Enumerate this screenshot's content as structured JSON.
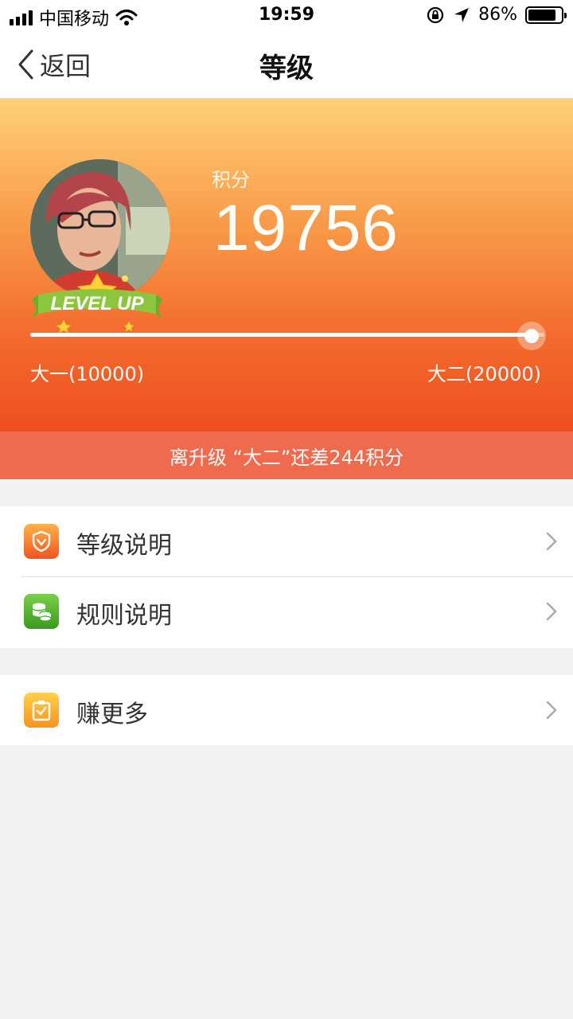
{
  "status_bar": {
    "carrier": "中国移动",
    "time": "19:59",
    "battery": "86%",
    "battery_level": 0.86
  },
  "nav": {
    "back_label": "返回",
    "title": "等级"
  },
  "hero": {
    "score_label": "积分",
    "score_value": "19756",
    "level_badge_text": "LEVEL UP",
    "current_level": "大一(10000)",
    "next_level": "大二(20000)",
    "progress_fraction": 0.9756,
    "remain_text": "离升级 “大二”还差244积分"
  },
  "menu": {
    "group1": [
      {
        "label": "等级说明",
        "icon": "shield-icon"
      },
      {
        "label": "规则说明",
        "icon": "coins-icon"
      }
    ],
    "group2": [
      {
        "label": "赚更多",
        "icon": "clipboard-check-icon"
      }
    ]
  },
  "colors": {
    "hero_top": "#ffd077",
    "hero_bottom": "#ee4f1f",
    "remain_bar": "#f06a4d"
  }
}
